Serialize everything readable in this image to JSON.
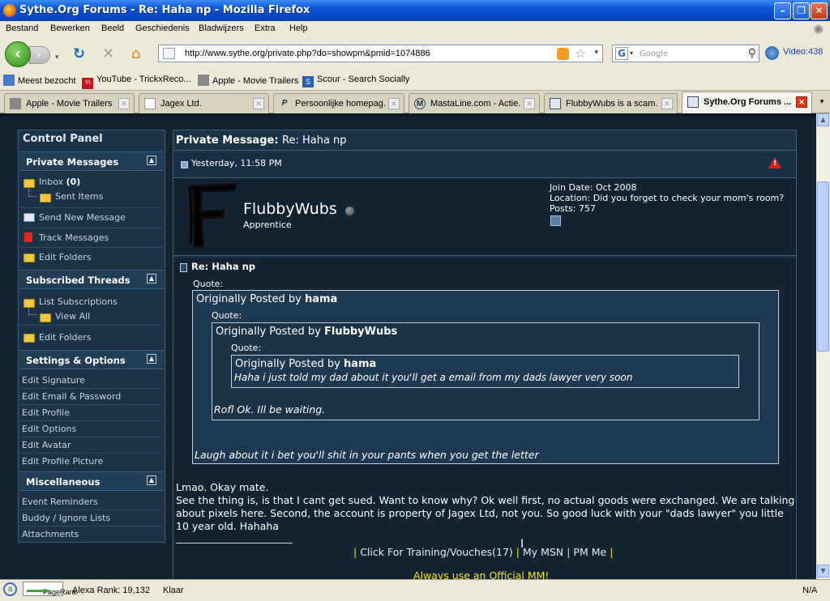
{
  "window": {
    "title": "Sythe.Org Forums - Re: Haha np - Mozilla Firefox",
    "minimize": "–",
    "maximize": "❐",
    "close": "✕"
  },
  "menu": [
    "Bestand",
    "Bewerken",
    "Beeld",
    "Geschiedenis",
    "Bladwijzers",
    "Extra",
    "Help"
  ],
  "nav": {
    "url": "http://www.sythe.org/private.php?do=showpm&pmid=1074886",
    "search_placeholder": "Google",
    "video": "Video:438"
  },
  "bookmarks": [
    "Meest bezocht",
    "YouTube - TrickxReco...",
    "Apple - Movie Trailers",
    "Scour - Search Socially"
  ],
  "tabs": [
    {
      "label": "Apple - Movie Trailers",
      "active": false
    },
    {
      "label": "Jagex Ltd.",
      "active": false
    },
    {
      "label": "Persoonlijke homepag...",
      "active": false
    },
    {
      "label": "MastaLine.com - Actie...",
      "active": false
    },
    {
      "label": "FlubbyWubs is a scam...",
      "active": false
    },
    {
      "label": "Sythe.Org Forums ...",
      "active": true
    }
  ],
  "control_panel": {
    "title": "Control Panel",
    "sections": {
      "private_messages": "Private Messages",
      "subscribed_threads": "Subscribed Threads",
      "settings": "Settings & Options",
      "misc": "Miscellaneous"
    },
    "inbox_label": "Inbox",
    "inbox_count": "(0)",
    "sent_items": "Sent Items",
    "send_new": "Send New Message",
    "track": "Track Messages",
    "edit_folders": "Edit Folders",
    "list_subs": "List Subscriptions",
    "view_all": "View All",
    "edit_folders2": "Edit Folders",
    "settings_links": [
      "Edit Signature",
      "Edit Email & Password",
      "Edit Profile",
      "Edit Options",
      "Edit Avatar",
      "Edit Profile Picture"
    ],
    "misc_links": [
      "Event Reminders",
      "Buddy / Ignore Lists",
      "Attachments"
    ]
  },
  "pm": {
    "title_label": "Private Message:",
    "title_subject": "Re: Haha np",
    "date": "Yesterday, 11:58 PM",
    "username": "FlubbyWubs",
    "usertitle": "Apprentice",
    "join_date": "Join Date: Oct 2008",
    "location": "Location: Did you forget to check your mom's room?",
    "posts": "Posts: 757",
    "subject": "Re: Haha np",
    "quote_label": "Quote:",
    "originally_posted_by": "Originally Posted by",
    "q1_author": "hama",
    "q2_author": "FlubbyWubs",
    "q3_author": "hama",
    "q3_text": "Haha i just told my dad about it you'll get a email from my dads lawyer very soon",
    "q2_text": "Rofl Ok. Ill be waiting.",
    "q1_text": "Laugh about it i bet you'll shit in your pants when you get the letter",
    "body_line1": "Lmao. Okay mate.",
    "body_line2": "See the thing is, is that I cant get sued. Want to know why? Ok well first, no actual goods were exchanged. We are talking about pixels here. Second, the account is property of Jagex Ltd, not you. So good luck with your \"dads lawyer\" you little 10 year old. Hahaha",
    "sig_sep1": "|",
    "sig_link1": "Click For Training/Vouches(17)",
    "sig_sep2": "|",
    "sig_link2": "My MSN",
    "sig_sep3": "|",
    "sig_link3": "PM Me",
    "sig_sep4": "|",
    "sig_line2": "Always use an Official MM!"
  },
  "status": {
    "pagerank": "PageRank",
    "alexa": "Alexa Rank: 19,132",
    "state": "Klaar",
    "na": "N/A"
  },
  "colors": {
    "page_bg": "#132332",
    "panel_bg": "#1b3347",
    "signature_yellow": "#f2e400"
  }
}
